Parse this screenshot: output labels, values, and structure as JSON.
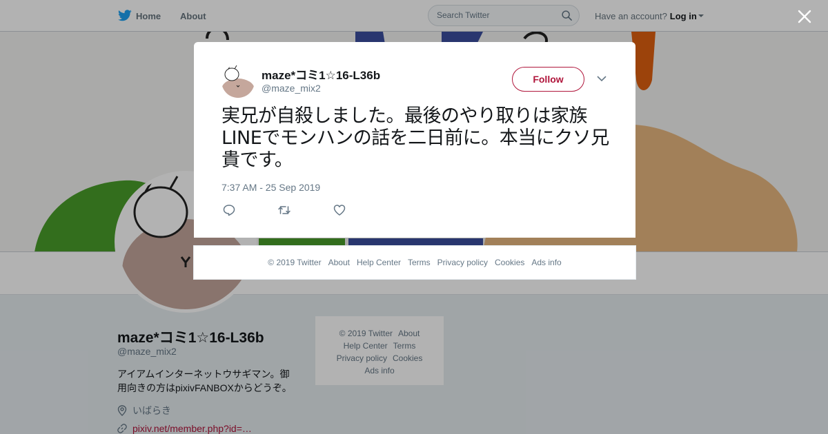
{
  "nav": {
    "home_label": "Home",
    "about_label": "About",
    "search_placeholder": "Search Twitter",
    "account_prompt": "Have an account?",
    "login_label": "Log in"
  },
  "profile": {
    "name": "maze*コミ1☆16-L36b",
    "handle": "@maze_mix2",
    "bio": "アイアムインターネットウサギマン。御用向きの方はpixivFANBOXからどうぞ。",
    "location": "いばらき",
    "url": "pixiv.net/member.php?id=…"
  },
  "side_footer": {
    "copyright": "© 2019 Twitter",
    "about": "About",
    "help": "Help Center",
    "terms": "Terms",
    "privacy": "Privacy policy",
    "cookies": "Cookies",
    "ads": "Ads info"
  },
  "tweet": {
    "author_name": "maze*コミ1☆16-L36b",
    "author_handle": "@maze_mix2",
    "follow_label": "Follow",
    "text": "実兄が自殺しました。最後のやり取りは家族LINEでモンハンの話を二日前に。本当にクソ兄貴です。",
    "timestamp": "7:37 AM - 25 Sep 2019"
  },
  "modal_footer": {
    "copyright": "© 2019 Twitter",
    "about": "About",
    "help": "Help Center",
    "terms": "Terms",
    "privacy": "Privacy policy",
    "cookies": "Cookies",
    "ads": "Ads info"
  },
  "colors": {
    "accent": "#b0153b",
    "twitter_blue": "#1da1f2",
    "muted_text": "#657786",
    "overlay": "rgba(0,0,0,0.3)"
  }
}
